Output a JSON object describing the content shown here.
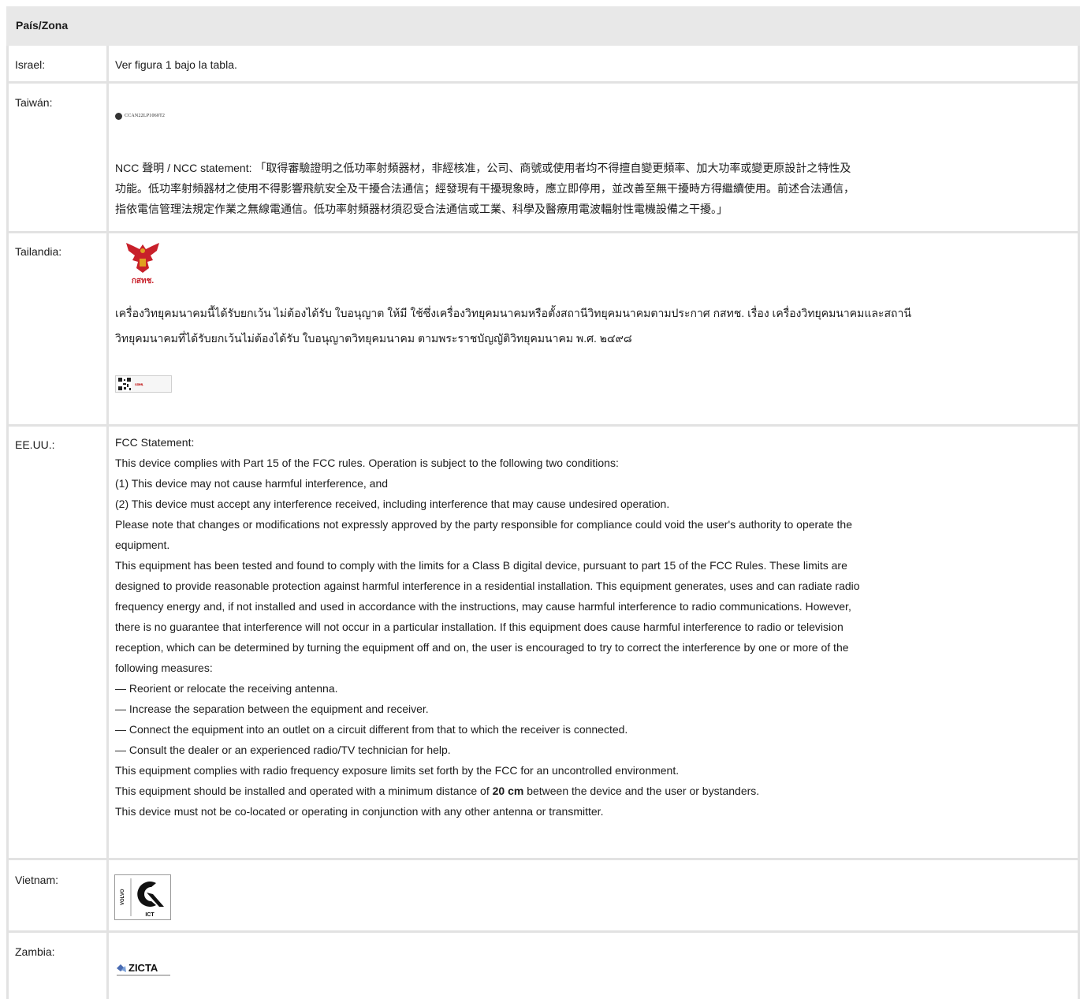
{
  "header": {
    "column_title": "País/Zona"
  },
  "rows": [
    {
      "label": "Israel:",
      "text": "Ver figura 1 bajo la tabla."
    },
    {
      "label": "Taiwán:",
      "cert_code": "CCAN22LP1060T2",
      "statement_lines": [
        "NCC 聲明 / NCC statement: 「取得審驗證明之低功率射頻器材，非經核准，公司、商號或使用者均不得擅自變更頻率、加大功率或變更原設計之特性及",
        "功能。低功率射頻器材之使用不得影響飛航安全及干擾合法通信；經發現有干擾現象時，應立即停用，並改善至無干擾時方得繼續使用。前述合法通信，",
        "指依電信管理法規定作業之無線電通信。低功率射頻器材須忍受合法通信或工業、科學及醫療用電波輻射性電機設備之干擾。」"
      ]
    },
    {
      "label": "Tailandia:",
      "logo_text": "กสทช.",
      "statement_lines": [
        "เครื่องวิทยุคมนาคมนี้ได้รับยกเว้น ไม่ต้องได้รับ ใบอนุญาต ให้มี ใช้ซึ่งเครื่องวิทยุคมนาคมหรือตั้งสถานีวิทยุคมนาคมตามประกาศ กสทช. เรื่อง เครื่องวิทยุคมนาคมและสถานี",
        "วิทยุคมนาคมที่ได้รับยกเว้นไม่ต้องได้รับ ใบอนุญาตวิทยุคมนาคม ตามพระราชบัญญัติวิทยุคมนาคม พ.ศ. ๒๔๙๘"
      ],
      "label_sticker_text": "กสทช."
    },
    {
      "label": "EE.UU.:",
      "lines": [
        "FCC Statement:",
        "This device complies with Part 15 of the FCC rules. Operation is subject to the following two conditions:",
        "(1) This device may not cause harmful interference, and",
        "(2) This device must accept any interference received, including interference that may cause undesired operation.",
        "Please note that changes or modifications not expressly approved by the party responsible for compliance could void the user's authority to operate the",
        "equipment.",
        "This equipment has been tested and found to comply with the limits for a Class B digital device, pursuant to part 15 of the FCC Rules. These limits are",
        "designed to provide reasonable protection against harmful interference in a residential installation. This equipment generates, uses and can radiate radio",
        "frequency energy and, if not installed and used in accordance with the instructions, may cause harmful interference to radio communications. However,",
        "there is no guarantee that interference will not occur in a particular installation. If this equipment does cause harmful interference to radio or television",
        "reception, which can be determined by turning the equipment off and on, the user is encouraged to try to correct the interference by one or more of the",
        "following measures:",
        "— Reorient or relocate the receiving antenna.",
        "— Increase the separation between the equipment and receiver.",
        "— Connect the equipment into an outlet on a circuit different from that to which the receiver is connected.",
        "— Consult the dealer or an experienced radio/TV technician for help.",
        "This equipment complies with radio frequency exposure limits set forth by the FCC for an uncontrolled environment."
      ],
      "distance_pre": "This equipment should be installed and operated with a minimum distance of ",
      "distance_bold": "20 cm",
      "distance_post": " between the device and the user or bystanders.",
      "last_line": "This device must not be co-located or operating in conjunction with any other antenna or transmitter."
    },
    {
      "label": "Vietnam:",
      "logo_side": "VOLVO",
      "logo_text": "ICT"
    },
    {
      "label": "Zambia:",
      "logo_text": "ZICTA"
    }
  ]
}
